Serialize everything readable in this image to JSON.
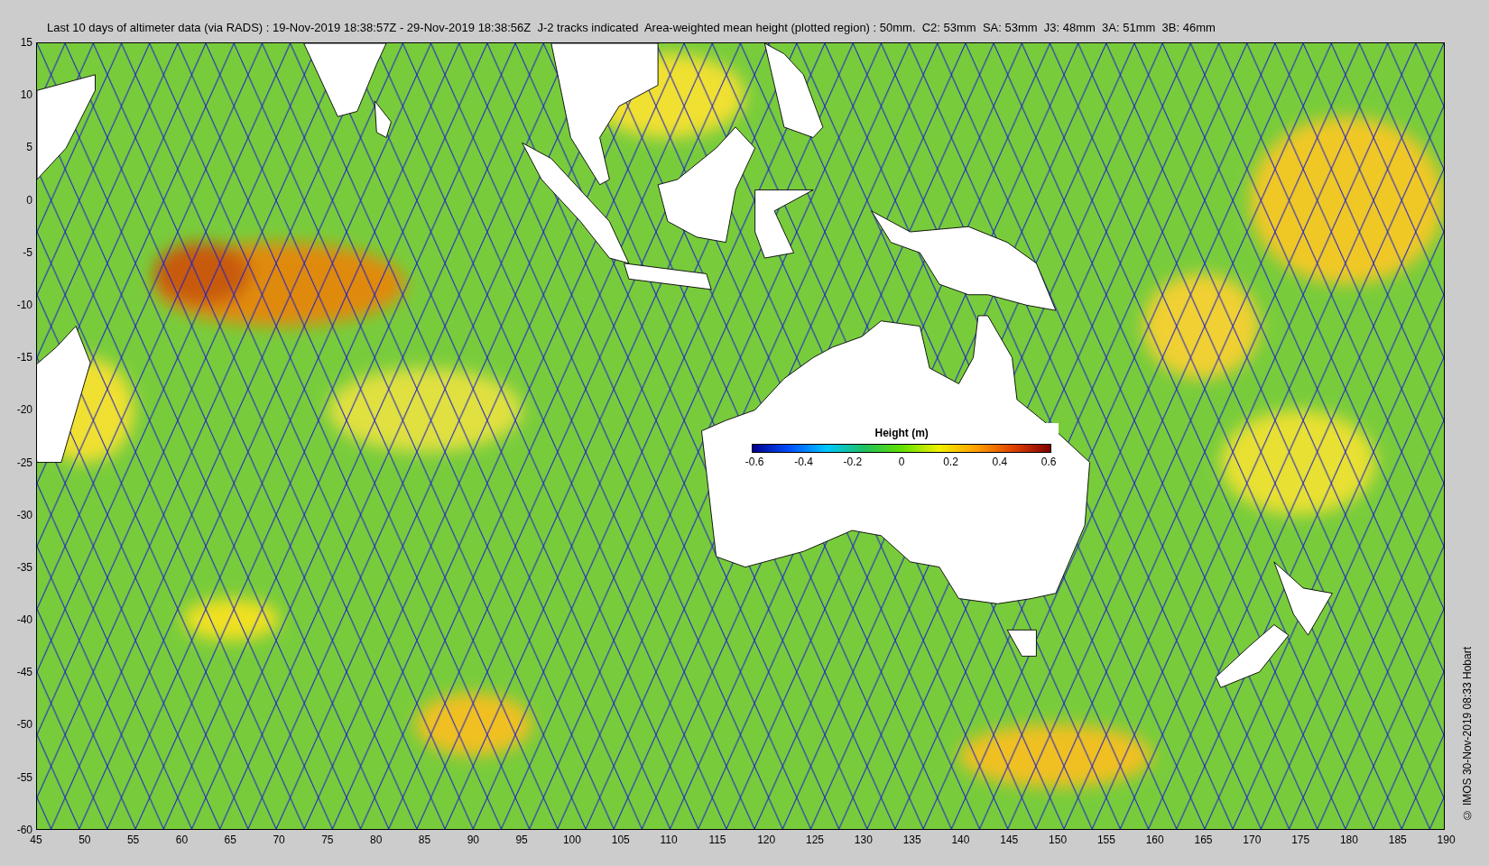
{
  "figure": {
    "title": "Last 10 days of altimeter data (via RADS) : 19-Nov-2019 18:38:57Z - 29-Nov-2019 18:38:56Z  J-2 tracks indicated  Area-weighted mean height (plotted region) : 50mm.  C2: 53mm  SA: 53mm  J3: 48mm  3A: 51mm  3B: 46mm",
    "credit": "© IMOS 30-Nov-2019 08:33 Hobart",
    "yticks": [
      "15",
      "10",
      "5",
      "0",
      "-5",
      "-10",
      "-15",
      "-20",
      "-25",
      "-30",
      "-35",
      "-40",
      "-45",
      "-50",
      "-55",
      "-60"
    ],
    "xticks": [
      "45",
      "50",
      "55",
      "60",
      "65",
      "70",
      "75",
      "80",
      "85",
      "90",
      "95",
      "100",
      "105",
      "110",
      "115",
      "120",
      "125",
      "130",
      "135",
      "140",
      "145",
      "150",
      "155",
      "160",
      "165",
      "170",
      "175",
      "180",
      "185",
      "190"
    ],
    "colorbar": {
      "title": "Height (m)",
      "ticks": [
        "-0.6",
        "-0.4",
        "-0.2",
        "0",
        "0.2",
        "0.4",
        "0.6"
      ]
    }
  }
}
